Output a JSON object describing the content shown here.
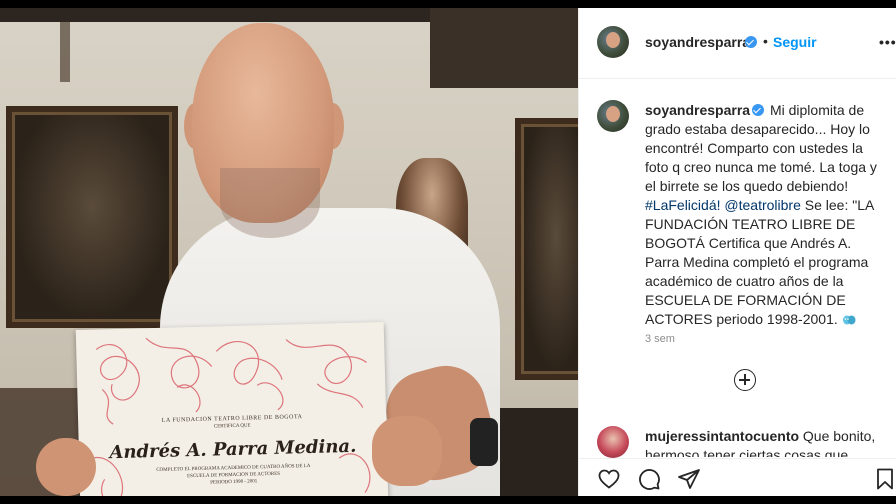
{
  "post": {
    "username": "soyandresparra",
    "dot": "•",
    "follow_label": "Seguir",
    "more_label": "•••"
  },
  "caption": {
    "username": "soyandresparra",
    "text_1": " Mi diplomita de grado estaba desaparecido... Hoy lo encontré! Comparto con ustedes la foto q creo nunca me tomé. La toga y el birrete se los quedo debiendo! ",
    "hashtag": "#LaFelicidá!",
    "mention": "@teatrolibre",
    "text_2": " Se lee: \"LA FUNDACIÓN TEATRO LIBRE DE BOGOTÁ Certifica que Andrés A. Parra Medina completó el programa académico de cuatro años de la ESCUELA DE FORMACIÓN DE ACTORES periodo 1998-2001. ",
    "emoji_name": "performing-arts-masks-icon"
  },
  "time_ago": "3 sem",
  "comment": {
    "username": "mujeressintantocuento",
    "text": " Que bonito, hermoso tener ciertas cosas que valen la pena"
  },
  "certificate": {
    "line1": "LA FUNDACION TEATRO LIBRE DE BOGOTA",
    "line2": "CERTIFICA QUE",
    "name": "Andrés A. Parra Medina.",
    "line3": "COMPLETO EL PROGRAMA ACADEMICO DE CUATRO AÑOS DE LA",
    "line4": "ESCUELA DE FORMACION DE ACTORES",
    "line5": "PERIODO 1998 - 2001",
    "line6": ""
  },
  "icons": {
    "like": "heart-icon",
    "comment": "comment-icon",
    "share": "paper-plane-icon",
    "save": "bookmark-icon",
    "add_comment": "plus-circle-icon"
  },
  "colors": {
    "link_blue": "#0095f6",
    "verified_blue": "#3897f0",
    "hashtag": "#00376b",
    "text": "#262626",
    "muted": "#8e8e8e"
  }
}
